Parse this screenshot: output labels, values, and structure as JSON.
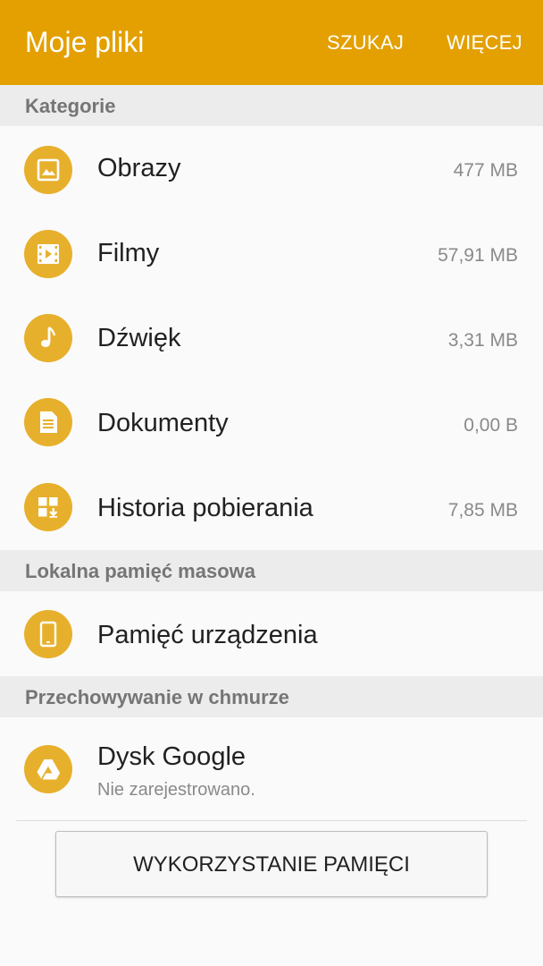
{
  "colors": {
    "accent": "#e3a000",
    "header_bg": "#ececec",
    "background": "#fafafa"
  },
  "appbar": {
    "title": "Moje pliki",
    "search_label": "SZUKAJ",
    "more_label": "WIĘCEJ"
  },
  "sections": {
    "categories": "Kategorie",
    "local_storage": "Lokalna pamięć masowa",
    "cloud_storage": "Przechowywanie w chmurze"
  },
  "categories": [
    {
      "label": "Obrazy",
      "size": "477 MB",
      "icon": "image-icon"
    },
    {
      "label": "Filmy",
      "size": "57,91 MB",
      "icon": "video-icon"
    },
    {
      "label": "Dźwięk",
      "size": "3,31 MB",
      "icon": "music-note-icon"
    },
    {
      "label": "Dokumenty",
      "size": "0,00 B",
      "icon": "document-icon"
    },
    {
      "label": "Historia pobierania",
      "size": "7,85 MB",
      "icon": "download-history-icon"
    }
  ],
  "local": {
    "device_storage_label": "Pamięć urządzenia",
    "icon": "phone-icon"
  },
  "cloud": {
    "google_drive_label": "Dysk Google",
    "google_drive_status": "Nie zarejestrowano.",
    "icon": "google-drive-icon"
  },
  "storage_usage_button": "WYKORZYSTANIE PAMIĘCI"
}
